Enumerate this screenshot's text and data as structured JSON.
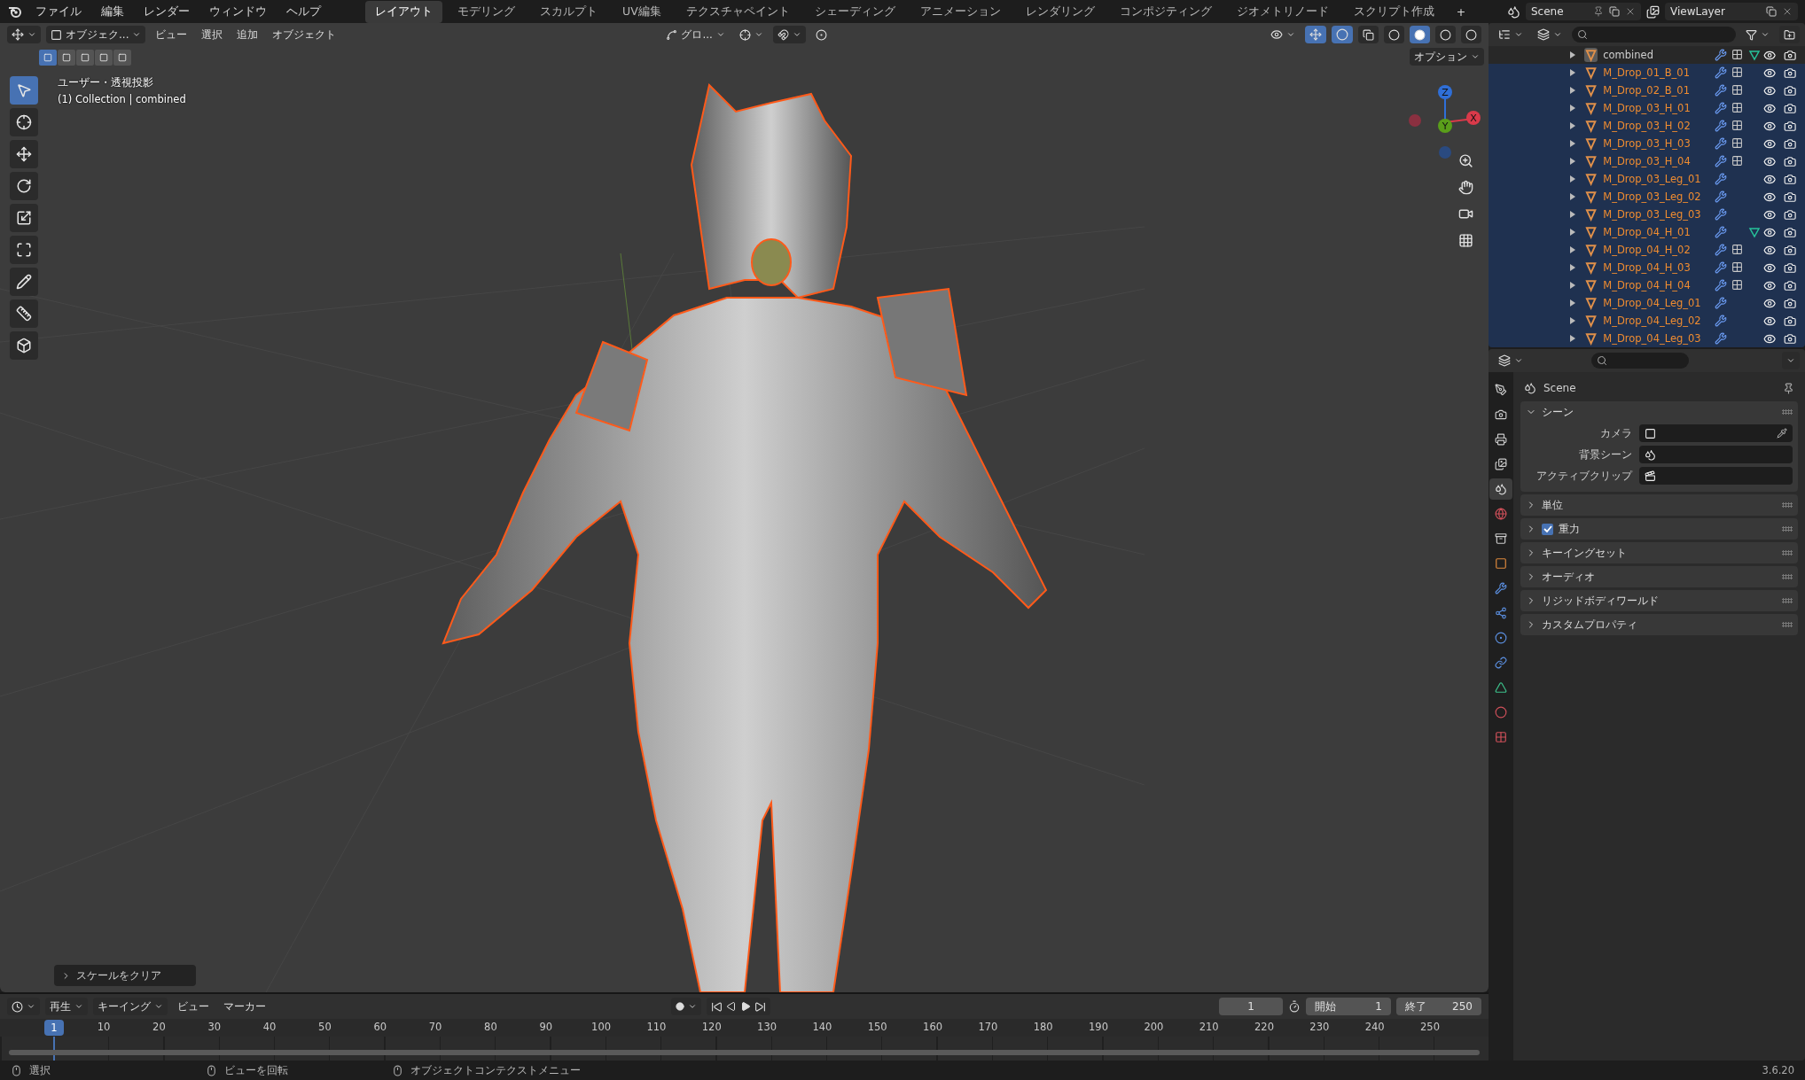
{
  "menu": [
    "ファイル",
    "編集",
    "レンダー",
    "ウィンドウ",
    "ヘルプ"
  ],
  "workspaces": [
    {
      "label": "レイアウト",
      "selected": true
    },
    {
      "label": "モデリング",
      "selected": false
    },
    {
      "label": "スカルプト",
      "selected": false
    },
    {
      "label": "UV編集",
      "selected": false
    },
    {
      "label": "テクスチャペイント",
      "selected": false
    },
    {
      "label": "シェーディング",
      "selected": false
    },
    {
      "label": "アニメーション",
      "selected": false
    },
    {
      "label": "レンダリング",
      "selected": false
    },
    {
      "label": "コンポジティング",
      "selected": false
    },
    {
      "label": "ジオメトリノード",
      "selected": false
    },
    {
      "label": "スクリプト作成",
      "selected": false
    }
  ],
  "add_workspace": "+",
  "scene_selector": {
    "value": "Scene"
  },
  "view_layer_selector": {
    "value": "ViewLayer"
  },
  "viewport": {
    "mode": "オブジェク...",
    "menus": [
      "ビュー",
      "選択",
      "追加",
      "オブジェクト"
    ],
    "transform_orientation": "グロ...",
    "options": "オプション",
    "select_modes": [
      {
        "selected": true
      },
      {
        "selected": false
      },
      {
        "selected": false
      },
      {
        "selected": false
      },
      {
        "selected": false
      }
    ],
    "shading_modes": [
      {
        "selected": false
      },
      {
        "selected": true
      },
      {
        "selected": false
      },
      {
        "selected": false
      }
    ],
    "overlay_text": [
      "ユーザー・透視投影",
      "(1) Collection | combined"
    ],
    "tools": [
      {
        "selected": true
      },
      {
        "selected": false
      },
      {
        "selected": false
      },
      {
        "selected": false
      },
      {
        "selected": false
      },
      {
        "selected": false
      },
      {
        "selected": false
      },
      {
        "selected": false
      },
      {
        "selected": false
      }
    ],
    "gizmo_axes": [
      {
        "label": "Z",
        "color": "#2f6fd8"
      },
      {
        "label": "Y",
        "color": "#5a9e1a"
      },
      {
        "label": "X",
        "color": "#d93a4a"
      }
    ],
    "last_operation": "スケールをクリア"
  },
  "outliner": {
    "items": [
      {
        "name": "combined",
        "selected": false,
        "modifiers": true,
        "shape_keys": true,
        "vertex_groups": true
      },
      {
        "name": "M_Drop_01_B_01",
        "selected": true,
        "modifiers": true,
        "shape_keys": true,
        "vertex_groups": false
      },
      {
        "name": "M_Drop_02_B_01",
        "selected": true,
        "modifiers": true,
        "shape_keys": true,
        "vertex_groups": false
      },
      {
        "name": "M_Drop_03_H_01",
        "selected": true,
        "modifiers": true,
        "shape_keys": true,
        "vertex_groups": false
      },
      {
        "name": "M_Drop_03_H_02",
        "selected": true,
        "modifiers": true,
        "shape_keys": true,
        "vertex_groups": false
      },
      {
        "name": "M_Drop_03_H_03",
        "selected": true,
        "modifiers": true,
        "shape_keys": true,
        "vertex_groups": false
      },
      {
        "name": "M_Drop_03_H_04",
        "selected": true,
        "modifiers": true,
        "shape_keys": true,
        "vertex_groups": false
      },
      {
        "name": "M_Drop_03_Leg_01",
        "selected": true,
        "modifiers": true,
        "shape_keys": false,
        "vertex_groups": false
      },
      {
        "name": "M_Drop_03_Leg_02",
        "selected": true,
        "modifiers": true,
        "shape_keys": false,
        "vertex_groups": false
      },
      {
        "name": "M_Drop_03_Leg_03",
        "selected": true,
        "modifiers": true,
        "shape_keys": false,
        "vertex_groups": false
      },
      {
        "name": "M_Drop_04_H_01",
        "selected": true,
        "modifiers": true,
        "shape_keys": false,
        "vertex_groups": true
      },
      {
        "name": "M_Drop_04_H_02",
        "selected": true,
        "modifiers": true,
        "shape_keys": true,
        "vertex_groups": false
      },
      {
        "name": "M_Drop_04_H_03",
        "selected": true,
        "modifiers": true,
        "shape_keys": true,
        "vertex_groups": false
      },
      {
        "name": "M_Drop_04_H_04",
        "selected": true,
        "modifiers": true,
        "shape_keys": true,
        "vertex_groups": false
      },
      {
        "name": "M_Drop_04_Leg_01",
        "selected": true,
        "modifiers": true,
        "shape_keys": false,
        "vertex_groups": false
      },
      {
        "name": "M_Drop_04_Leg_02",
        "selected": true,
        "modifiers": true,
        "shape_keys": false,
        "vertex_groups": false
      },
      {
        "name": "M_Drop_04_Leg_03",
        "selected": true,
        "modifiers": true,
        "shape_keys": false,
        "vertex_groups": false
      }
    ]
  },
  "properties": {
    "tabs": [
      {
        "selected": false
      },
      {
        "selected": false
      },
      {
        "selected": false
      },
      {
        "selected": false
      },
      {
        "selected": true
      },
      {
        "selected": false
      },
      {
        "selected": false
      },
      {
        "selected": false
      },
      {
        "selected": false
      },
      {
        "selected": false
      },
      {
        "selected": false
      },
      {
        "selected": false
      },
      {
        "selected": false
      },
      {
        "selected": false
      },
      {
        "selected": false
      }
    ],
    "title": "Scene",
    "panels": [
      {
        "title": "シーン",
        "kind": "plain",
        "expanded": true,
        "fields": [
          "カメラ",
          "背景シーン",
          "アクティブクリップ"
        ]
      },
      {
        "title": "単位",
        "kind": "plain",
        "expanded": false
      },
      {
        "title": "重力",
        "kind": "toggle",
        "expanded": false,
        "checked": true
      },
      {
        "title": "キーイングセット",
        "kind": "plain",
        "expanded": false
      },
      {
        "title": "オーディオ",
        "kind": "plain",
        "expanded": false
      },
      {
        "title": "リジッドボディワールド",
        "kind": "plain",
        "expanded": false
      },
      {
        "title": "カスタムプロパティ",
        "kind": "plain",
        "expanded": false
      }
    ]
  },
  "timeline": {
    "menus": [
      {
        "label": "再生",
        "dropdown": true
      },
      {
        "label": "キーイング",
        "dropdown": true
      },
      {
        "label": "ビュー",
        "dropdown": false
      },
      {
        "label": "マーカー",
        "dropdown": false
      }
    ],
    "current_frame": "1",
    "start_label": "開始",
    "start": "1",
    "end_label": "終了",
    "end": "250",
    "playhead": "1",
    "ruler": [
      "10",
      "20",
      "30",
      "40",
      "50",
      "60",
      "70",
      "80",
      "90",
      "100",
      "110",
      "120",
      "130",
      "140",
      "150",
      "160",
      "170",
      "180",
      "190",
      "200",
      "210",
      "220",
      "230",
      "240",
      "250"
    ]
  },
  "status_bar": {
    "hints": [
      "選択",
      "ビューを回転",
      "オブジェクトコンテクストメニュー"
    ],
    "version": "3.6.20"
  }
}
